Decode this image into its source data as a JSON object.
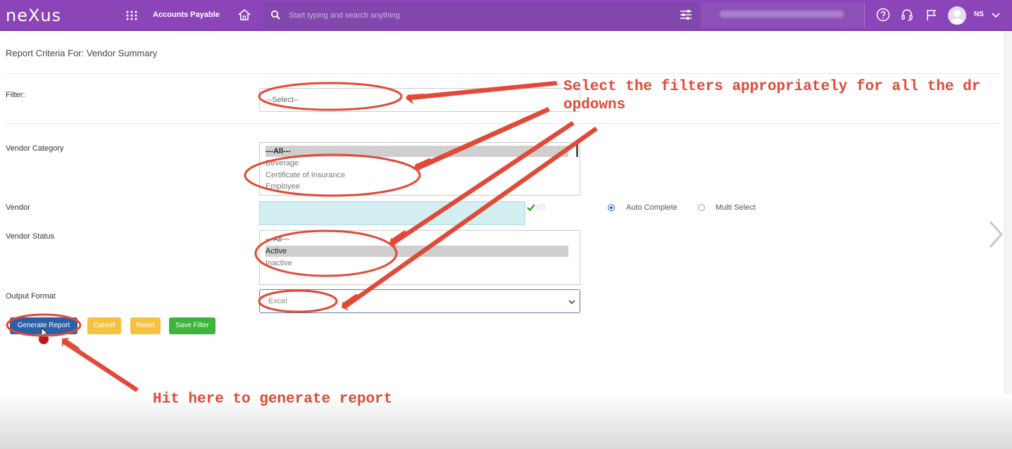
{
  "header": {
    "logo": "neXus",
    "module": "Accounts Payable",
    "search_placeholder": "Start typing and search anything",
    "user_initials": "NS"
  },
  "page": {
    "title": "Report Criteria For: Vendor Summary"
  },
  "form": {
    "filter": {
      "label": "Filter:",
      "value": "--Select--"
    },
    "vendor_category": {
      "label": "Vendor Category",
      "options": [
        "---All---",
        "Beverage",
        "Certificate of Insurance",
        "Employee"
      ]
    },
    "vendor": {
      "label": "Vendor",
      "count": "(0)",
      "mode_options": [
        "Auto Complete",
        "Multi Select"
      ],
      "selected_mode": "Auto Complete"
    },
    "vendor_status": {
      "label": "Vendor Status",
      "options": [
        "---All---",
        "Active",
        "Inactive"
      ],
      "selected": "Active"
    },
    "output_format": {
      "label": "Output Format",
      "value": "Excel"
    }
  },
  "buttons": {
    "generate": "Generate Report",
    "cancel": "Cancel",
    "reset": "Reset",
    "save_filter": "Save Filter"
  },
  "annotations": {
    "filters_note": "Select the filters appropriately for all the dr\nopdowns",
    "generate_note": "Hit here to generate report"
  },
  "colors": {
    "header_bg": "#8b45b8",
    "primary_button": "#2d5fa7",
    "warning_button": "#f5c23e",
    "success_button": "#3bb53b",
    "annotation_red": "#e04a38"
  }
}
